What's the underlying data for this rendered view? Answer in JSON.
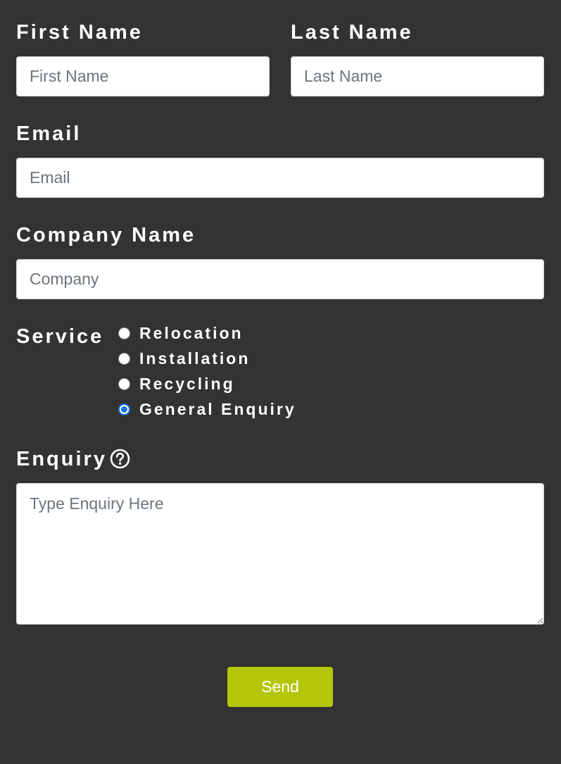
{
  "form": {
    "first_name": {
      "label": "First Name",
      "placeholder": "First Name",
      "value": ""
    },
    "last_name": {
      "label": "Last Name",
      "placeholder": "Last Name",
      "value": ""
    },
    "email": {
      "label": "Email",
      "placeholder": "Email",
      "value": ""
    },
    "company": {
      "label": "Company Name",
      "placeholder": "Company",
      "value": ""
    },
    "service": {
      "label": "Service",
      "options": [
        {
          "label": "Relocation",
          "checked": false
        },
        {
          "label": "Installation",
          "checked": false
        },
        {
          "label": "Recycling",
          "checked": false
        },
        {
          "label": "General Enquiry",
          "checked": true
        }
      ]
    },
    "enquiry": {
      "label": "Enquiry",
      "placeholder": "Type Enquiry Here",
      "value": "",
      "help_icon": "question-circle-icon"
    },
    "send_label": "Send"
  },
  "colors": {
    "background": "#333333",
    "text": "#ffffff",
    "send_button": "#b5c607",
    "radio_checked": "#1a73e8"
  }
}
